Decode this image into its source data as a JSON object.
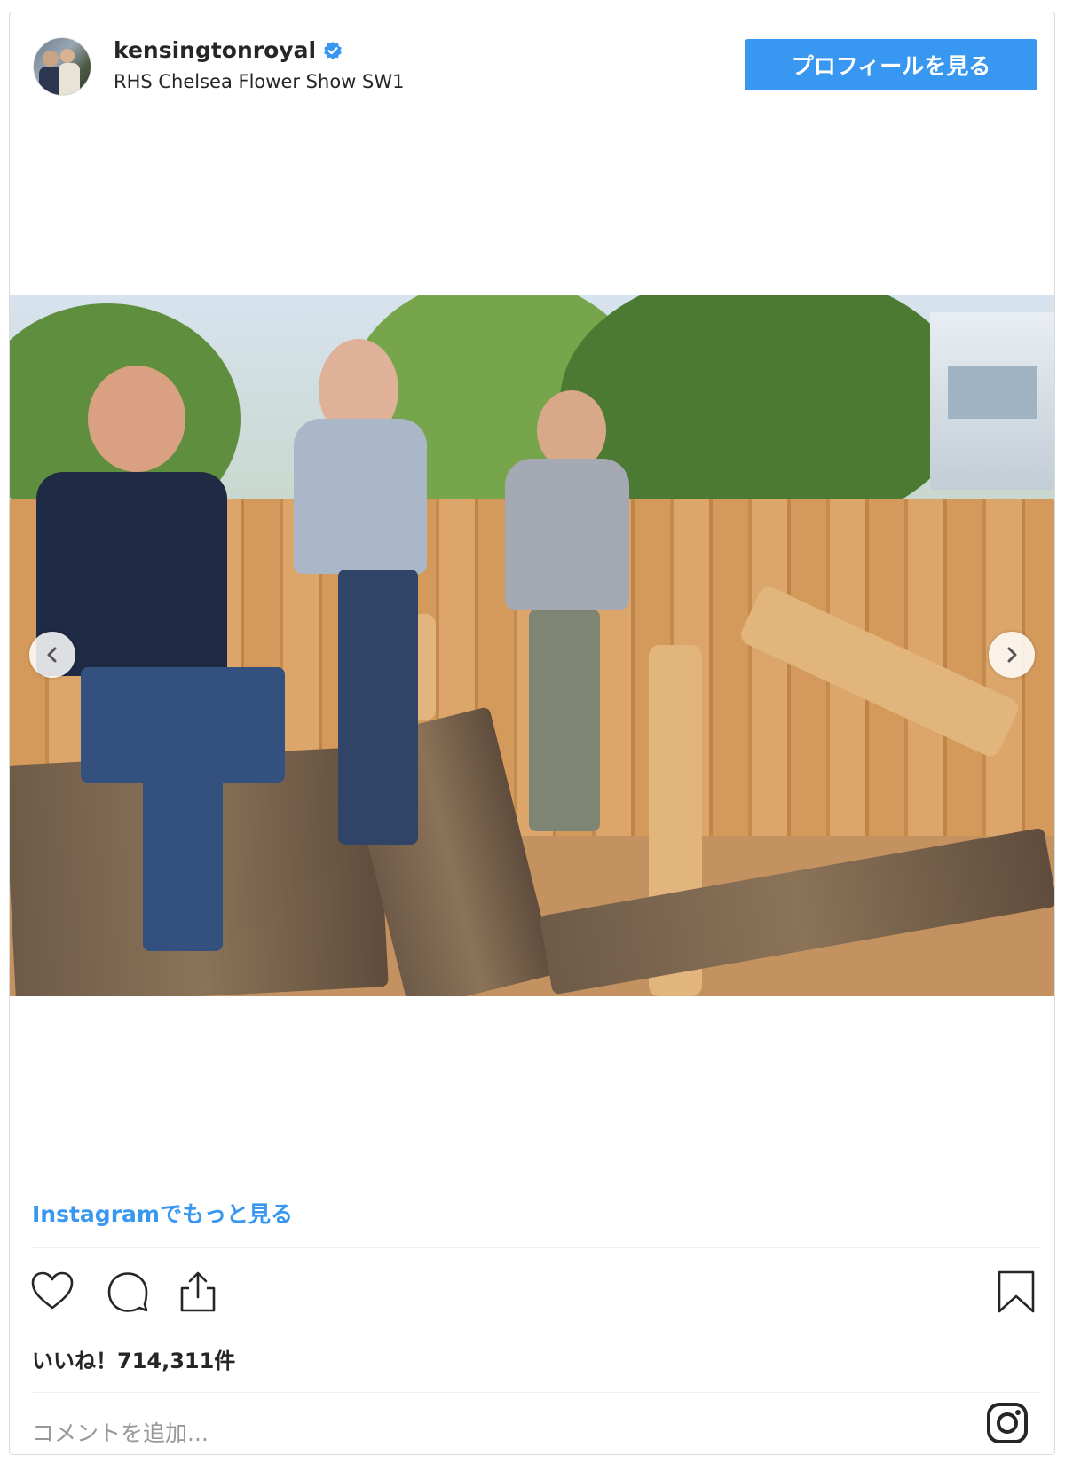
{
  "post": {
    "username": "kensingtonroyal",
    "verified": true,
    "location": "RHS Chelsea Flower Show SW1",
    "profile_button_label": "プロフィールを見る",
    "more_on_instagram": "Instagramでもっと見る",
    "likes_text": "いいね！714,311件",
    "comment_placeholder": "コメントを追加..."
  },
  "icons": {
    "verified": "verified-badge-icon",
    "like": "heart-icon",
    "comment": "comment-bubble-icon",
    "share": "share-icon",
    "save": "bookmark-icon",
    "prev": "chevron-left-icon",
    "next": "chevron-right-icon",
    "brand": "instagram-icon"
  },
  "colors": {
    "link_blue": "#3897f0",
    "text": "#262626",
    "placeholder": "#999999",
    "border": "#dbdbdb"
  }
}
